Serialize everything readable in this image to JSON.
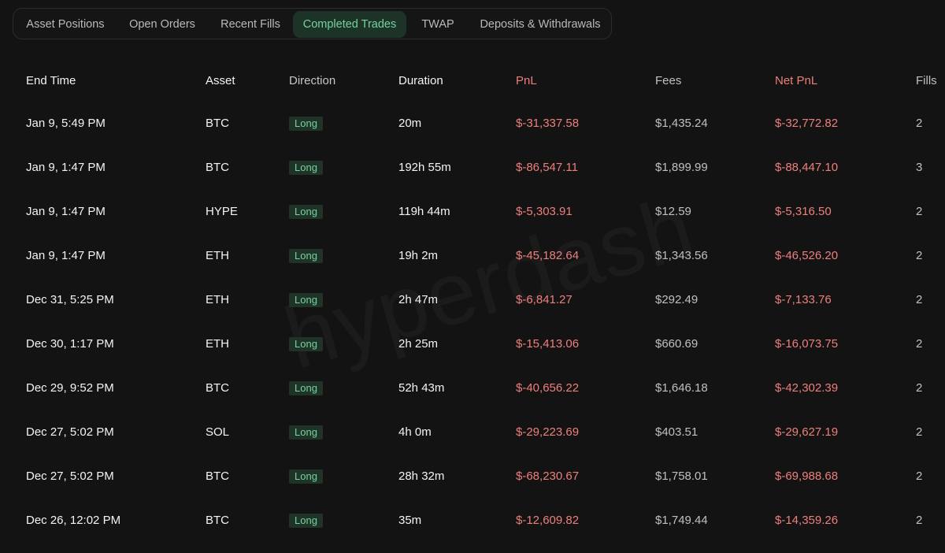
{
  "tabs": [
    "Asset Positions",
    "Open Orders",
    "Recent Fills",
    "Completed Trades",
    "TWAP",
    "Deposits & Withdrawals"
  ],
  "active_tab": "Completed Trades",
  "table": {
    "headers": [
      "End Time",
      "Asset",
      "Direction",
      "Duration",
      "PnL",
      "Fees",
      "Net PnL",
      "Fills"
    ],
    "rows": [
      [
        "Jan 9, 5:49 PM",
        "BTC",
        "Long",
        "20m",
        "$-31,337.58",
        "$1,435.24",
        "$-32,772.82",
        "2"
      ],
      [
        "Jan 9, 1:47 PM",
        "BTC",
        "Long",
        "192h 55m",
        "$-86,547.11",
        "$1,899.99",
        "$-88,447.10",
        "3"
      ],
      [
        "Jan 9, 1:47 PM",
        "HYPE",
        "Long",
        "119h 44m",
        "$-5,303.91",
        "$12.59",
        "$-5,316.50",
        "2"
      ],
      [
        "Jan 9, 1:47 PM",
        "ETH",
        "Long",
        "19h 2m",
        "$-45,182.64",
        "$1,343.56",
        "$-46,526.20",
        "2"
      ],
      [
        "Dec 31, 5:25 PM",
        "ETH",
        "Long",
        "2h 47m",
        "$-6,841.27",
        "$292.49",
        "$-7,133.76",
        "2"
      ],
      [
        "Dec 30, 1:17 PM",
        "ETH",
        "Long",
        "2h 25m",
        "$-15,413.06",
        "$660.69",
        "$-16,073.75",
        "2"
      ],
      [
        "Dec 29, 9:52 PM",
        "BTC",
        "Long",
        "52h 43m",
        "$-40,656.22",
        "$1,646.18",
        "$-42,302.39",
        "2"
      ],
      [
        "Dec 27, 5:02 PM",
        "SOL",
        "Long",
        "4h 0m",
        "$-29,223.69",
        "$403.51",
        "$-29,627.19",
        "2"
      ],
      [
        "Dec 27, 5:02 PM",
        "BTC",
        "Long",
        "28h 32m",
        "$-68,230.67",
        "$1,758.01",
        "$-69,988.68",
        "2"
      ],
      [
        "Dec 26, 12:02 PM",
        "BTC",
        "Long",
        "35m",
        "$-12,609.82",
        "$1,749.44",
        "$-14,359.26",
        "2"
      ]
    ]
  },
  "watermark": "hyperdash",
  "colors": {
    "background": "#131313",
    "active_tab_bg": "#1d3328",
    "active_tab_text": "#74d39c",
    "long_badge_bg": "#1f3328",
    "long_badge_text": "#75d39d",
    "negative": "#ef7f7b",
    "muted": "#bfc0bf"
  }
}
